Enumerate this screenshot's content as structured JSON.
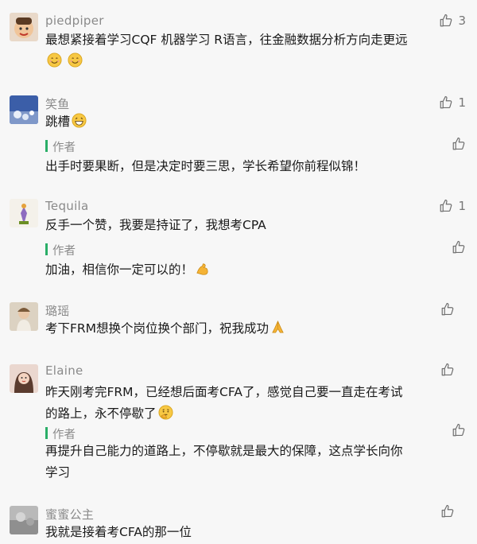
{
  "comments": [
    {
      "name": "piedpiper",
      "likes": "3",
      "text": "最想紧接着学习CQF 机器学习 R语言，往金融数据分析方向走更远",
      "emoji": "smile-emoji"
    },
    {
      "name": "笑鱼",
      "likes": "1",
      "text": "跳槽",
      "emoji": "grin-emoji",
      "reply": {
        "label": "作者",
        "text": "出手时要果断，但是决定时要三思，学长希望你前程似锦！"
      }
    },
    {
      "name": "Tequila",
      "likes": "1",
      "text": "反手一个赞，我要是持证了，我想考CPA",
      "reply": {
        "label": "作者",
        "text": "加油，相信你一定可以的！",
        "emoji": "flexed-bicep-emoji"
      }
    },
    {
      "name": "璐瑶",
      "likes": "",
      "text": "考下FRM想换个岗位换个部门，祝我成功",
      "emoji": "pray-emoji"
    },
    {
      "name": "Elaine",
      "likes": "",
      "text_line1": "昨天刚考完FRM，已经想后面考CFA了，感觉自己要一直走在考试",
      "text_line2": "的路上，永不停歇了",
      "emoji": "thinking-emoji",
      "reply": {
        "label": "作者",
        "text_line1": "再提升自己能力的道路上，不停歇就是最大的保障，这点学长向你",
        "text_line2": "学习"
      }
    },
    {
      "name": "蜜蜜公主",
      "likes": "",
      "text": "我就是接着考CFA的那一位"
    }
  ]
}
